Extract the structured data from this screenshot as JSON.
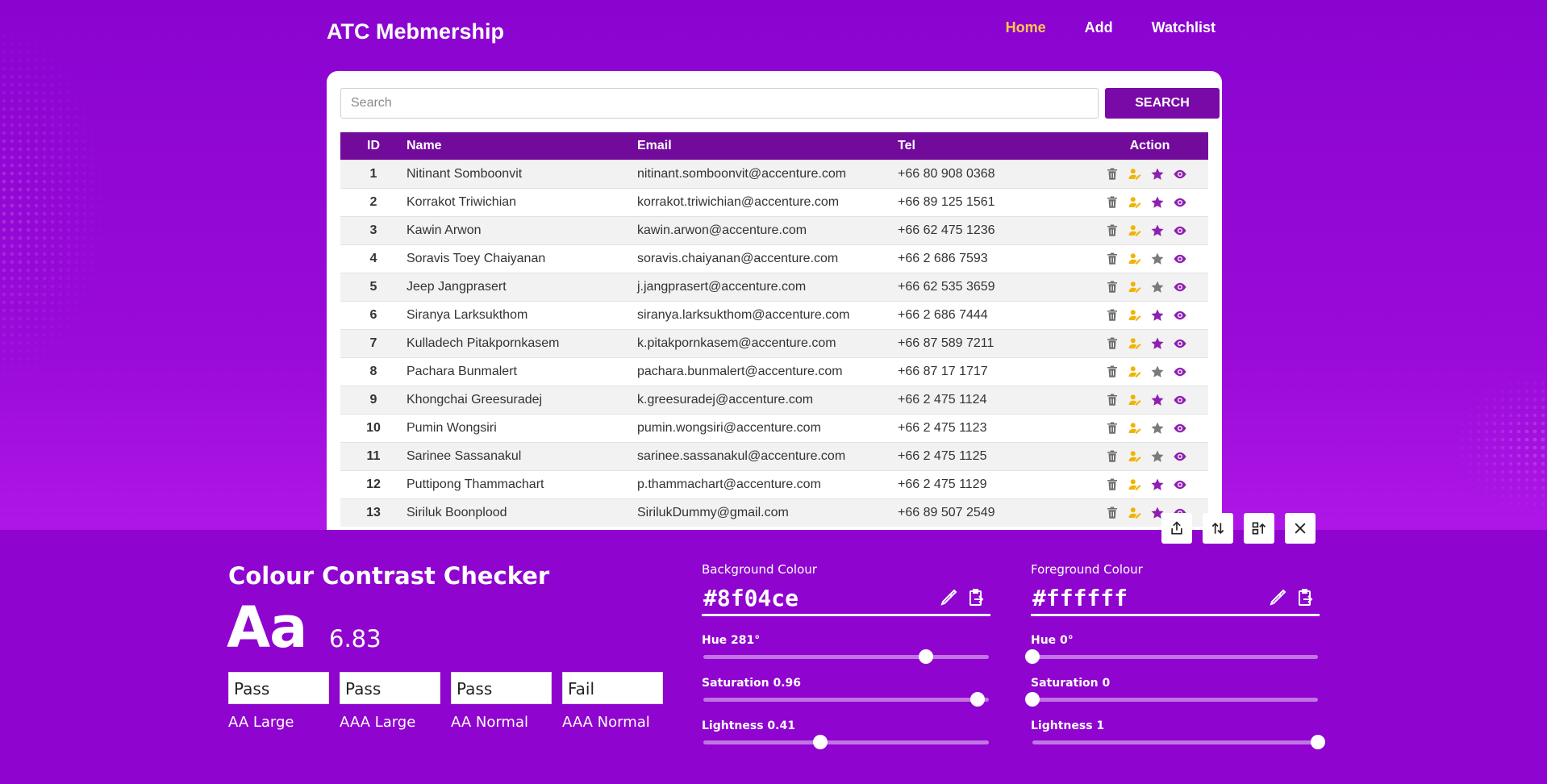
{
  "app": {
    "brand": "ATC Mebmership",
    "nav": [
      {
        "label": "Home",
        "active": true
      },
      {
        "label": "Add",
        "active": false
      },
      {
        "label": "Watchlist",
        "active": false
      }
    ]
  },
  "search": {
    "placeholder": "Search",
    "value": "",
    "button_label": "SEARCH"
  },
  "table": {
    "headers": [
      "ID",
      "Name",
      "Email",
      "Tel",
      "Action"
    ],
    "rows": [
      {
        "id": "1",
        "name": "Nitinant Somboonvit",
        "email": "nitinant.somboonvit@accenture.com",
        "tel": "+66 80 908 0368",
        "watchlisted": true
      },
      {
        "id": "2",
        "name": "Korrakot Triwichian",
        "email": "korrakot.triwichian@accenture.com",
        "tel": "+66 89 125 1561",
        "watchlisted": true
      },
      {
        "id": "3",
        "name": "Kawin Arwon",
        "email": "kawin.arwon@accenture.com",
        "tel": "+66 62 475 1236",
        "watchlisted": true
      },
      {
        "id": "4",
        "name": "Soravis Toey Chaiyanan",
        "email": "soravis.chaiyanan@accenture.com",
        "tel": "+66 2 686 7593",
        "watchlisted": false
      },
      {
        "id": "5",
        "name": "Jeep Jangprasert",
        "email": "j.jangprasert@accenture.com",
        "tel": "+66 62 535 3659",
        "watchlisted": false
      },
      {
        "id": "6",
        "name": "Siranya Larksukthom",
        "email": "siranya.larksukthom@accenture.com",
        "tel": "+66 2 686 7444",
        "watchlisted": true
      },
      {
        "id": "7",
        "name": "Kulladech Pitakpornkasem",
        "email": "k.pitakpornkasem@accenture.com",
        "tel": "+66 87 589 7211",
        "watchlisted": true
      },
      {
        "id": "8",
        "name": "Pachara Bunmalert",
        "email": "pachara.bunmalert@accenture.com",
        "tel": "+66 87 17 1717",
        "watchlisted": false
      },
      {
        "id": "9",
        "name": "Khongchai Greesuradej",
        "email": "k.greesuradej@accenture.com",
        "tel": "+66 2 475 1124",
        "watchlisted": true
      },
      {
        "id": "10",
        "name": "Pumin Wongsiri",
        "email": "pumin.wongsiri@accenture.com",
        "tel": "+66 2 475 1123",
        "watchlisted": false
      },
      {
        "id": "11",
        "name": "Sarinee Sassanakul",
        "email": "sarinee.sassanakul@accenture.com",
        "tel": "+66 2 475 1125",
        "watchlisted": false
      },
      {
        "id": "12",
        "name": "Puttipong Thammachart",
        "email": "p.thammachart@accenture.com",
        "tel": "+66 2 475 1129",
        "watchlisted": true
      },
      {
        "id": "13",
        "name": "Siriluk Boonplood",
        "email": "SirilukDummy@gmail.com",
        "tel": "+66 89 507 2549",
        "watchlisted": true
      }
    ],
    "action_icons": [
      "trash-icon",
      "user-edit-icon",
      "star-icon",
      "eye-icon"
    ]
  },
  "colors": {
    "accent": "#8f04ce",
    "header_bg": "#720a9c",
    "nav_active": "#ffc94d",
    "star_on": "#8e1fb0",
    "star_off": "#7a7a7a",
    "edit": "#f0b400",
    "trash": "#6e6e6e"
  },
  "contrast_checker": {
    "title": "Colour Contrast Checker",
    "sample_text": "Aa",
    "ratio": "6.83",
    "results": [
      {
        "status": "Pass",
        "level": "AA Large"
      },
      {
        "status": "Pass",
        "level": "AAA Large"
      },
      {
        "status": "Pass",
        "level": "AA Normal"
      },
      {
        "status": "Fail",
        "level": "AAA Normal"
      }
    ],
    "background": {
      "label": "Background Colour",
      "hex": "#8f04ce",
      "hue_label": "Hue 281°",
      "hue": 281,
      "saturation_label": "Saturation 0.96",
      "saturation": 0.96,
      "lightness_label": "Lightness 0.41",
      "lightness": 0.41
    },
    "foreground": {
      "label": "Foreground Colour",
      "hex": "#ffffff",
      "hue_label": "Hue 0°",
      "hue": 0,
      "saturation_label": "Saturation 0",
      "saturation": 0,
      "lightness_label": "Lightness 1",
      "lightness": 1
    },
    "toolbar": [
      "share-icon",
      "swap-icon",
      "export-icon",
      "close-icon"
    ]
  }
}
